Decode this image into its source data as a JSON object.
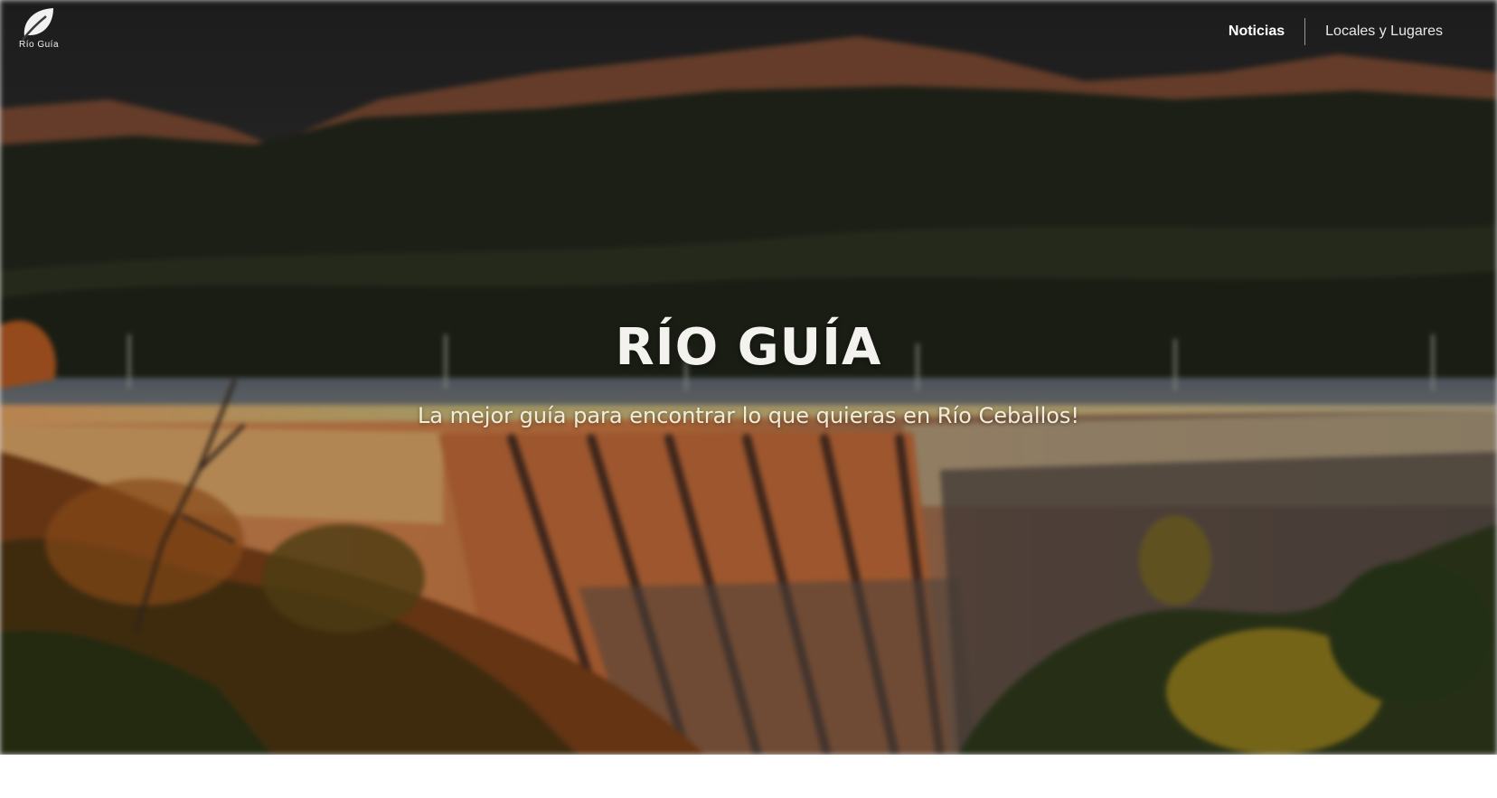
{
  "brand": {
    "logo_icon": "leaf-icon",
    "logo_text": "Río Guía"
  },
  "nav": {
    "items": [
      {
        "label": "Noticias",
        "active": true
      },
      {
        "label": "Locales y Lugares",
        "active": false
      }
    ]
  },
  "hero": {
    "title": "RÍO GUÍA",
    "subtitle": "La mejor guía para encontrar lo que quieras en Río Ceballos!"
  },
  "colors": {
    "title_text": "#f4f2ef",
    "subtitle_text": "#f3ecd8",
    "sky": "#2e2e2e",
    "dam_wall": "#c9794a"
  }
}
